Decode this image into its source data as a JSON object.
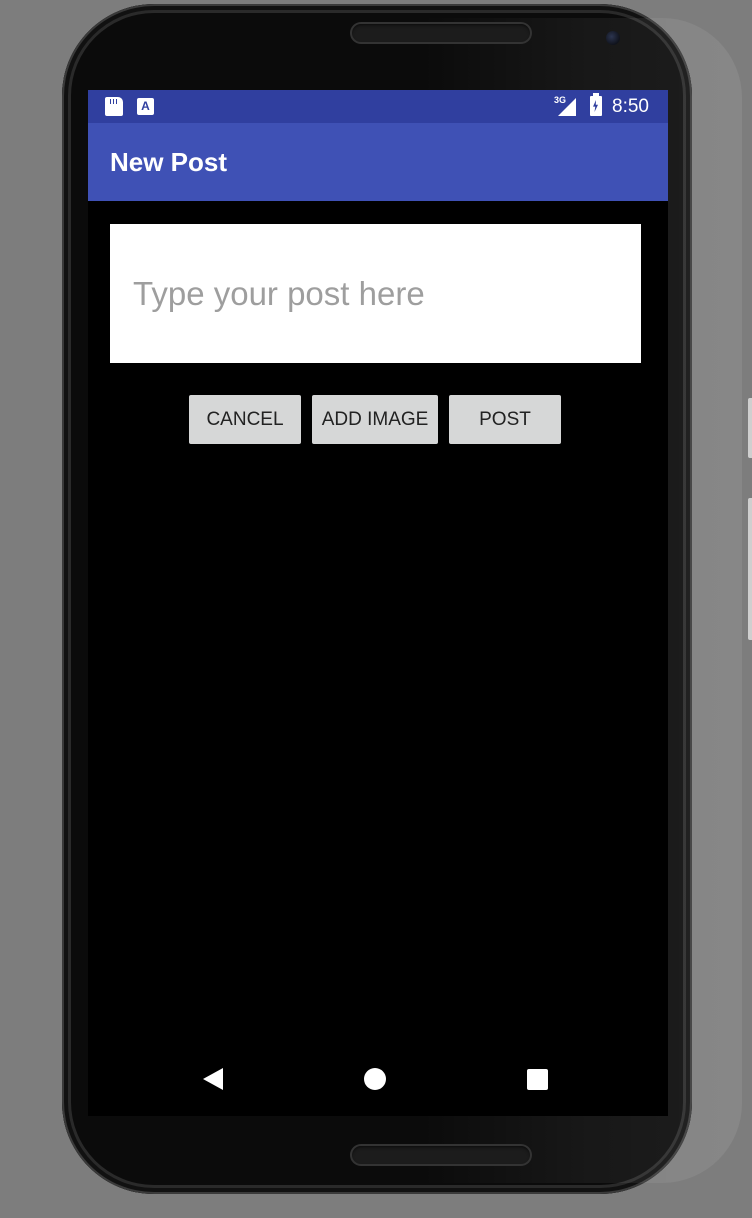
{
  "status_bar": {
    "network": "3G",
    "time": "8:50",
    "icons": [
      "sd-card-icon",
      "a-notification-icon",
      "signal-icon",
      "battery-charging-icon"
    ]
  },
  "app_bar": {
    "title": "New Post"
  },
  "post_input": {
    "placeholder": "Type your post here",
    "value": ""
  },
  "actions": {
    "cancel_label": "CANCEL",
    "add_image_label": "ADD IMAGE",
    "post_label": "POST"
  },
  "nav_bar": {
    "icons": [
      "back-icon",
      "home-icon",
      "recents-icon"
    ]
  },
  "colors": {
    "status_bar": "#303f9f",
    "app_bar": "#3f51b5",
    "button": "#d6d7d7",
    "screen_bg": "#000000"
  }
}
